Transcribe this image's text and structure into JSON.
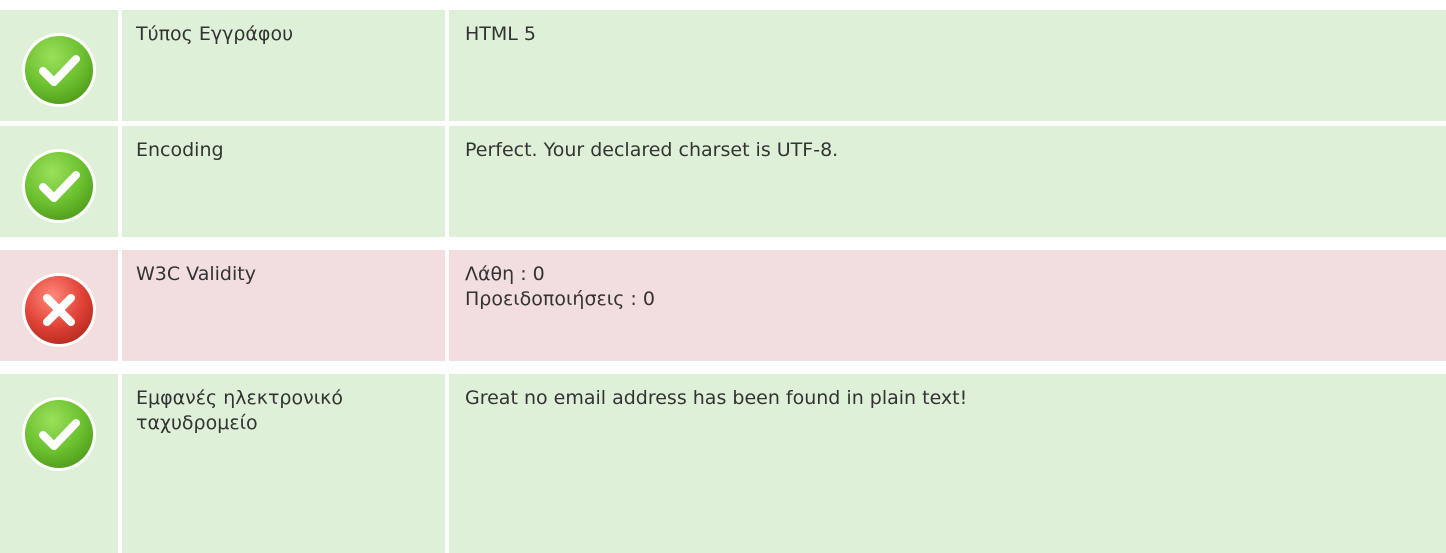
{
  "colors": {
    "success_bg": "#dff0d8",
    "error_bg": "#f2dede",
    "success_icon": "#6cc12f",
    "error_icon": "#e14236"
  },
  "rows": [
    {
      "status": "pass",
      "icon": "check-circle-icon",
      "label": "Τύπος Εγγράφου",
      "value_lines": [
        "HTML 5"
      ]
    },
    {
      "status": "pass",
      "icon": "check-circle-icon",
      "label": "Encoding",
      "value_lines": [
        "Perfect. Your declared charset is UTF-8."
      ]
    },
    {
      "status": "fail",
      "icon": "cross-circle-icon",
      "label": "W3C Validity",
      "value_lines": [
        "Λάθη : 0",
        "Προειδοποιήσεις : 0"
      ]
    },
    {
      "status": "pass",
      "icon": "check-circle-icon",
      "label": "Εμφανές ηλεκτρονικό ταχυδρομείο",
      "value_lines": [
        "Great no email address has been found in plain text!"
      ]
    }
  ]
}
